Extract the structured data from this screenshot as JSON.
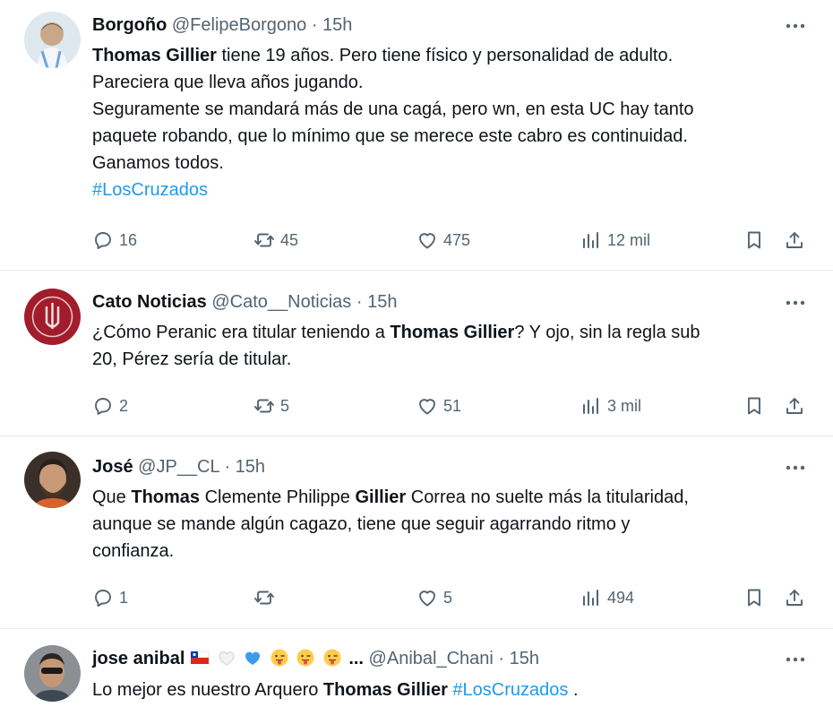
{
  "tweets": [
    {
      "name": "Borgoño",
      "handle": "@FelipeBorgono",
      "separator": "·",
      "time": "15h",
      "body": {
        "l1_bold": "Thomas Gillier",
        "l1_rest": " tiene 19 años. Pero tiene físico y personalidad de adulto.",
        "l2": "Pareciera que lleva años jugando.",
        "l3": "Seguramente se mandará más de una cagá, pero wn, en esta UC hay tanto",
        "l4": "paquete robando, que lo mínimo que se merece este cabro es continuidad.",
        "l5": "Ganamos todos.",
        "hashtag": "#LosCruzados"
      },
      "replies": "16",
      "retweets": "45",
      "likes": "475",
      "views": "12 mil"
    },
    {
      "name": "Cato Noticias",
      "handle": "@Cato__Noticias",
      "separator": "·",
      "time": "15h",
      "body": {
        "l1_pre": "¿Cómo Peranic era titular teniendo a ",
        "l1_bold": "Thomas Gillier",
        "l1_post": "? Y ojo, sin la regla sub",
        "l2": "20, Pérez sería de titular."
      },
      "replies": "2",
      "retweets": "5",
      "likes": "51",
      "views": "3 mil"
    },
    {
      "name": "José",
      "handle": "@JP__CL",
      "separator": "·",
      "time": "15h",
      "body": {
        "l1_pre": "Que ",
        "l1_bold1": "Thomas",
        "l1_mid": " Clemente Philippe ",
        "l1_bold2": "Gillier",
        "l1_post": " Correa no suelte más la titularidad,",
        "l2": "aunque se mande algún cagazo, tiene que seguir agarrando ritmo y",
        "l3": "confianza."
      },
      "replies": "1",
      "retweets": "",
      "likes": "5",
      "views": "494"
    },
    {
      "name": "jose anibal",
      "name_suffix": "...",
      "handle": "@Anibal_Chani",
      "separator": "·",
      "time": "15h",
      "body": {
        "l1_pre": "Lo mejor es nuestro Arquero ",
        "l1_bold": "Thomas Gillier",
        "l1_space": " ",
        "hashtag": "#LosCruzados",
        "l1_post": " ."
      }
    }
  ],
  "icons": {
    "reply": "reply-icon",
    "retweet": "retweet-icon",
    "like": "heart-icon",
    "views": "views-icon",
    "bookmark": "bookmark-icon",
    "share": "share-icon",
    "more": "more-icon"
  },
  "colors": {
    "text": "#0f1419",
    "secondary": "#536471",
    "link": "#1d9bf0",
    "divider": "#e6ecf0"
  }
}
